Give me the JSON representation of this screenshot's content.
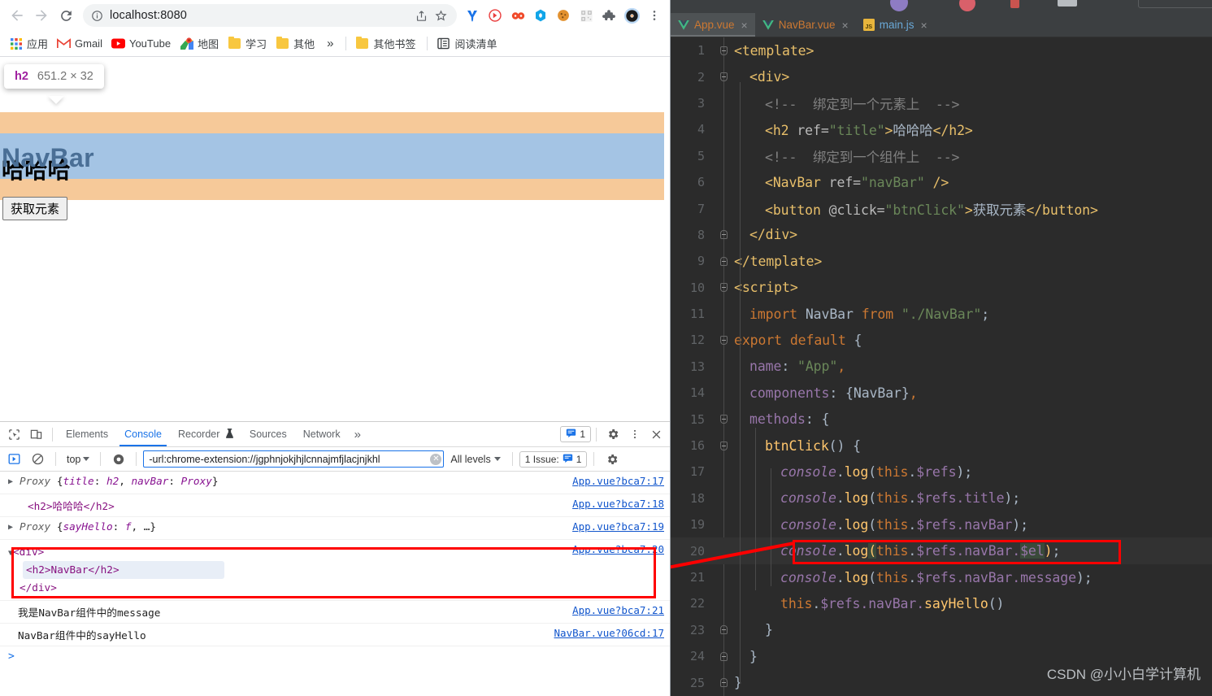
{
  "browser": {
    "omnibox": {
      "url": "localhost:8080",
      "info_icon": "info-circle-icon",
      "share_icon": "share-icon",
      "star_icon": "bookmark-star-icon"
    },
    "nav": {
      "back": "back-arrow-icon",
      "forward": "forward-arrow-icon",
      "reload": "reload-icon"
    },
    "extensions": [
      "y-extension-icon",
      "circle-arrow-extension-icon",
      "infinity-extension-icon",
      "blue-hex-extension-icon",
      "cookie-extension-icon",
      "qr-extension-icon",
      "puzzle-extensions-icon",
      "vinyl-extension-icon",
      "kebab-menu-icon"
    ],
    "bookmarks": [
      {
        "label": "应用",
        "icon": "apps-grid-icon"
      },
      {
        "label": "Gmail",
        "icon": "gmail-icon"
      },
      {
        "label": "YouTube",
        "icon": "youtube-icon"
      },
      {
        "label": "地图",
        "icon": "maps-icon"
      },
      {
        "label": "学习",
        "icon": "folder-icon"
      },
      {
        "label": "其他",
        "icon": "folder-icon"
      }
    ],
    "bookmarks_overflow": "»",
    "bookmarks_right": [
      {
        "label": "其他书签",
        "icon": "folder-icon"
      },
      {
        "label": "阅读清单",
        "icon": "reading-list-icon"
      }
    ]
  },
  "page": {
    "h2_hidden_text": "哈哈哈",
    "navbar_text": "NavBar",
    "button_label": "获取元素",
    "tooltip": {
      "tag": "h2",
      "dimensions": "651.2 × 32"
    },
    "highlight_colors": {
      "margin": "#f6c999",
      "content": "#a4c4e4"
    }
  },
  "devtools": {
    "left_icons": [
      "inspect-element-icon",
      "device-toolbar-icon"
    ],
    "tabs": [
      {
        "label": "Elements",
        "active": false
      },
      {
        "label": "Console",
        "active": true
      },
      {
        "label": "Recorder",
        "active": false,
        "badge_icon": "recorder-flask-icon"
      },
      {
        "label": "Sources",
        "active": false
      },
      {
        "label": "Network",
        "active": false
      }
    ],
    "tabs_overflow": "»",
    "message_count": "1",
    "right_icons": [
      "settings-gear-icon",
      "kebab-menu-icon",
      "close-icon"
    ],
    "filterbar": {
      "execute_icon": "execute-icon",
      "clear_console_icon": "clear-console-icon",
      "context": "top",
      "eye_icon": "live-expression-eye-icon",
      "filter_value": "-url:chrome-extension://jgphnjokjhjlcnnajmfjlacjnjkhl",
      "filter_clear_icon": "clear-input-icon",
      "levels": "All levels",
      "issues": "1 Issue:",
      "issues_count": "1",
      "settings_icon": "settings-gear-icon"
    },
    "logs": [
      {
        "type": "object",
        "expandable": true,
        "parts": [
          {
            "t": "proxy",
            "v": "Proxy"
          },
          {
            "t": "plain",
            "v": " {"
          },
          {
            "t": "key",
            "v": "title"
          },
          {
            "t": "plain",
            "v": ": "
          },
          {
            "t": "key",
            "v": "h2"
          },
          {
            "t": "plain",
            "v": ", "
          },
          {
            "t": "key",
            "v": "navBar"
          },
          {
            "t": "plain",
            "v": ": "
          },
          {
            "t": "key",
            "v": "Proxy"
          },
          {
            "t": "plain",
            "v": "}"
          }
        ],
        "source": "App.vue?bca7:17"
      },
      {
        "type": "dom-inline",
        "expandable": false,
        "text": "<h2>哈哈哈</h2>",
        "source": "App.vue?bca7:18"
      },
      {
        "type": "object",
        "expandable": true,
        "parts": [
          {
            "t": "proxy",
            "v": "Proxy"
          },
          {
            "t": "plain",
            "v": " {"
          },
          {
            "t": "key",
            "v": "sayHello"
          },
          {
            "t": "plain",
            "v": ": "
          },
          {
            "t": "key",
            "v": "f"
          },
          {
            "t": "plain",
            "v": ", …}"
          }
        ],
        "source": "App.vue?bca7:19"
      },
      {
        "type": "dom-block",
        "expandable": true,
        "annotated": true,
        "lines": [
          "<div>",
          "<h2>NavBar</h2>",
          "</div>"
        ],
        "highlight_line": 1,
        "source": "App.vue?bca7:20"
      },
      {
        "type": "text",
        "text": "我是NavBar组件中的message",
        "source": "App.vue?bca7:21"
      },
      {
        "type": "text",
        "text": "NavBar组件中的sayHello",
        "source": "NavBar.vue?06cd:17"
      }
    ],
    "prompt": ">"
  },
  "ide": {
    "tabs": [
      {
        "label": "App.vue",
        "icon": "vue-file-icon",
        "active": true,
        "close": "×"
      },
      {
        "label": "NavBar.vue",
        "icon": "vue-file-icon",
        "active": false,
        "close": "×"
      },
      {
        "label": "main.js",
        "icon": "js-file-icon",
        "active": false,
        "close": "×"
      }
    ],
    "watermark": "CSDN @小小白学计算机",
    "annotated_line": 20,
    "code": [
      {
        "n": 1,
        "indent": 0,
        "fold": "down",
        "tokens": [
          {
            "c": "t-tag",
            "v": "<template>"
          }
        ]
      },
      {
        "n": 2,
        "indent": 1,
        "fold": "down",
        "tokens": [
          {
            "c": "t-tag",
            "v": "<div>"
          }
        ]
      },
      {
        "n": 3,
        "indent": 2,
        "fold": "",
        "tokens": [
          {
            "c": "t-cmt",
            "v": "<!--  绑定到一个元素上  -->"
          }
        ]
      },
      {
        "n": 4,
        "indent": 2,
        "fold": "",
        "tokens": [
          {
            "c": "t-tag",
            "v": "<h2 "
          },
          {
            "c": "t-attr",
            "v": "ref="
          },
          {
            "c": "t-str",
            "v": "\"title\""
          },
          {
            "c": "t-tag",
            "v": ">"
          },
          {
            "c": "t-txt",
            "v": "哈哈哈"
          },
          {
            "c": "t-tag",
            "v": "</h2>"
          }
        ]
      },
      {
        "n": 5,
        "indent": 2,
        "fold": "",
        "tokens": [
          {
            "c": "t-cmt",
            "v": "<!--  绑定到一个组件上  -->"
          }
        ]
      },
      {
        "n": 6,
        "indent": 2,
        "fold": "",
        "tokens": [
          {
            "c": "t-tag",
            "v": "<NavBar "
          },
          {
            "c": "t-attr",
            "v": "ref="
          },
          {
            "c": "t-str",
            "v": "\"navBar\""
          },
          {
            "c": "t-tag",
            "v": " />"
          }
        ]
      },
      {
        "n": 7,
        "indent": 2,
        "fold": "",
        "tokens": [
          {
            "c": "t-tag",
            "v": "<button "
          },
          {
            "c": "t-attr",
            "v": "@click="
          },
          {
            "c": "t-str",
            "v": "\"btnClick\""
          },
          {
            "c": "t-tag",
            "v": ">"
          },
          {
            "c": "t-txt",
            "v": "获取元素"
          },
          {
            "c": "t-tag",
            "v": "</button>"
          }
        ]
      },
      {
        "n": 8,
        "indent": 1,
        "fold": "up",
        "tokens": [
          {
            "c": "t-tag",
            "v": "</div>"
          }
        ]
      },
      {
        "n": 9,
        "indent": 0,
        "fold": "up",
        "tokens": [
          {
            "c": "t-tag",
            "v": "</template>"
          }
        ]
      },
      {
        "n": 10,
        "indent": 0,
        "fold": "down",
        "tokens": [
          {
            "c": "t-tag",
            "v": "<script>"
          }
        ]
      },
      {
        "n": 11,
        "indent": 1,
        "fold": "",
        "tokens": [
          {
            "c": "t-kw",
            "v": "import "
          },
          {
            "c": "t-cls",
            "v": "NavBar "
          },
          {
            "c": "t-kw",
            "v": "from "
          },
          {
            "c": "t-str",
            "v": "\"./NavBar\""
          },
          {
            "c": "t-punc",
            "v": ";"
          }
        ]
      },
      {
        "n": 12,
        "indent": 0,
        "fold": "down",
        "tokens": [
          {
            "c": "t-kw",
            "v": "export default "
          },
          {
            "c": "t-punc",
            "v": "{"
          }
        ]
      },
      {
        "n": 13,
        "indent": 1,
        "fold": "",
        "tokens": [
          {
            "c": "t-prop",
            "v": "name"
          },
          {
            "c": "t-punc",
            "v": ": "
          },
          {
            "c": "t-str",
            "v": "\"App\""
          },
          {
            "c": "t-kw",
            "v": ","
          }
        ]
      },
      {
        "n": 14,
        "indent": 1,
        "fold": "",
        "tokens": [
          {
            "c": "t-prop",
            "v": "components"
          },
          {
            "c": "t-punc",
            "v": ": {"
          },
          {
            "c": "t-cls",
            "v": "NavBar"
          },
          {
            "c": "t-punc",
            "v": "}"
          },
          {
            "c": "t-kw",
            "v": ","
          }
        ]
      },
      {
        "n": 15,
        "indent": 1,
        "fold": "down",
        "tokens": [
          {
            "c": "t-prop",
            "v": "methods"
          },
          {
            "c": "t-punc",
            "v": ": {"
          }
        ]
      },
      {
        "n": 16,
        "indent": 2,
        "fold": "down",
        "tokens": [
          {
            "c": "t-fn",
            "v": "btnClick"
          },
          {
            "c": "t-punc",
            "v": "() {"
          }
        ]
      },
      {
        "n": 17,
        "indent": 3,
        "fold": "",
        "tokens": [
          {
            "c": "t-con",
            "v": "console"
          },
          {
            "c": "t-punc",
            "v": "."
          },
          {
            "c": "t-fn",
            "v": "log"
          },
          {
            "c": "t-punc",
            "v": "("
          },
          {
            "c": "t-kw",
            "v": "this"
          },
          {
            "c": "t-punc",
            "v": "."
          },
          {
            "c": "t-prop",
            "v": "$refs"
          },
          {
            "c": "t-punc",
            "v": ");"
          }
        ]
      },
      {
        "n": 18,
        "indent": 3,
        "fold": "",
        "tokens": [
          {
            "c": "t-con",
            "v": "console"
          },
          {
            "c": "t-punc",
            "v": "."
          },
          {
            "c": "t-fn",
            "v": "log"
          },
          {
            "c": "t-punc",
            "v": "("
          },
          {
            "c": "t-kw",
            "v": "this"
          },
          {
            "c": "t-punc",
            "v": "."
          },
          {
            "c": "t-prop",
            "v": "$refs.title"
          },
          {
            "c": "t-punc",
            "v": ");"
          }
        ]
      },
      {
        "n": 19,
        "indent": 3,
        "fold": "",
        "tokens": [
          {
            "c": "t-con",
            "v": "console"
          },
          {
            "c": "t-punc",
            "v": "."
          },
          {
            "c": "t-fn",
            "v": "log"
          },
          {
            "c": "t-punc",
            "v": "("
          },
          {
            "c": "t-kw",
            "v": "this"
          },
          {
            "c": "t-punc",
            "v": "."
          },
          {
            "c": "t-prop",
            "v": "$refs.navBar"
          },
          {
            "c": "t-punc",
            "v": ");"
          }
        ]
      },
      {
        "n": 20,
        "indent": 3,
        "fold": "",
        "highlighted": true,
        "tokens": [
          {
            "c": "t-con",
            "v": "console"
          },
          {
            "c": "t-punc",
            "v": "."
          },
          {
            "c": "t-fn",
            "v": "log"
          },
          {
            "c": "t-bracket sel-hi",
            "v": "("
          },
          {
            "c": "t-kw",
            "v": "this"
          },
          {
            "c": "t-punc",
            "v": "."
          },
          {
            "c": "t-prop",
            "v": "$refs.navBar."
          },
          {
            "c": "t-prop sel-hi",
            "v": "$el"
          },
          {
            "c": "t-bracket",
            "v": ")"
          },
          {
            "c": "t-punc",
            "v": ";"
          }
        ]
      },
      {
        "n": 21,
        "indent": 3,
        "fold": "",
        "tokens": [
          {
            "c": "t-con",
            "v": "console"
          },
          {
            "c": "t-punc",
            "v": "."
          },
          {
            "c": "t-fn",
            "v": "log"
          },
          {
            "c": "t-punc",
            "v": "("
          },
          {
            "c": "t-kw",
            "v": "this"
          },
          {
            "c": "t-punc",
            "v": "."
          },
          {
            "c": "t-prop",
            "v": "$refs.navBar.message"
          },
          {
            "c": "t-punc",
            "v": ");"
          }
        ]
      },
      {
        "n": 22,
        "indent": 3,
        "fold": "",
        "tokens": [
          {
            "c": "t-kw",
            "v": "this"
          },
          {
            "c": "t-punc",
            "v": "."
          },
          {
            "c": "t-prop",
            "v": "$refs.navBar."
          },
          {
            "c": "t-fn",
            "v": "sayHello"
          },
          {
            "c": "t-punc",
            "v": "()"
          }
        ]
      },
      {
        "n": 23,
        "indent": 2,
        "fold": "up",
        "tokens": [
          {
            "c": "t-punc",
            "v": "}"
          }
        ]
      },
      {
        "n": 24,
        "indent": 1,
        "fold": "up",
        "tokens": [
          {
            "c": "t-punc",
            "v": "}"
          }
        ]
      },
      {
        "n": 25,
        "indent": 0,
        "fold": "up",
        "tokens": [
          {
            "c": "t-punc",
            "v": "}"
          }
        ]
      }
    ]
  }
}
